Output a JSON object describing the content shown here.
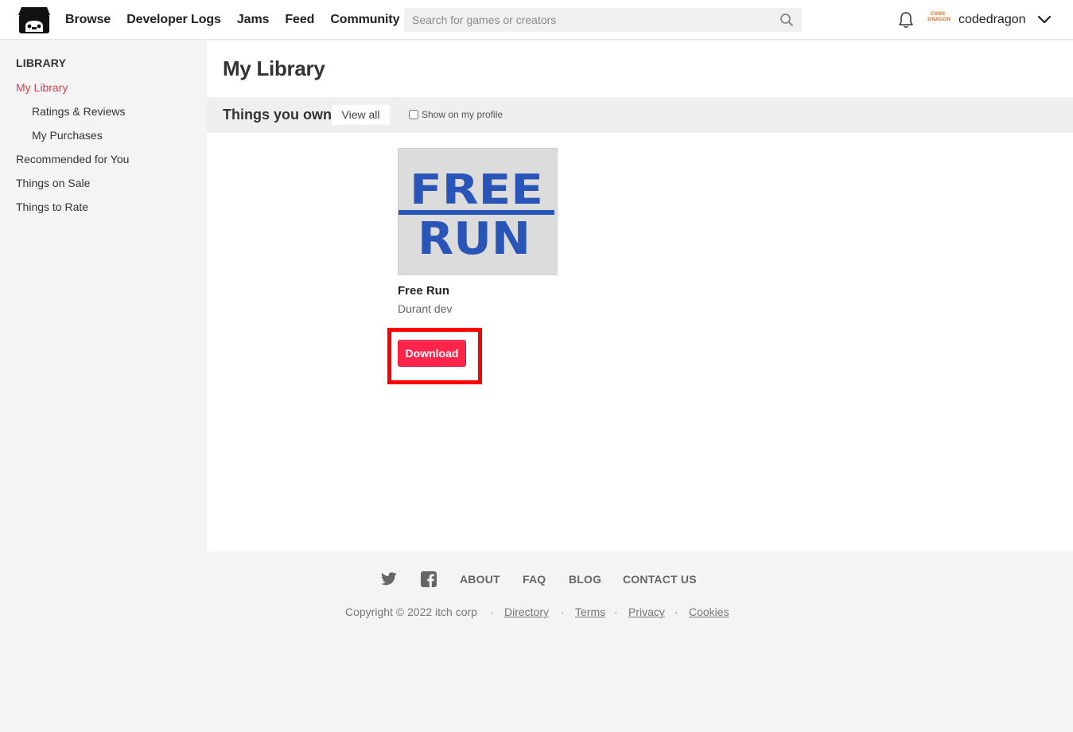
{
  "header": {
    "logo_icon": "itchio-storefront-logo-icon",
    "nav": [
      "Browse",
      "Developer Logs",
      "Jams",
      "Feed",
      "Community"
    ],
    "search_placeholder": "Search for games or creators",
    "search_icon": "search-icon",
    "notifications_icon": "bell-icon",
    "avatar_text": "CODE DRAGON",
    "username": "codedragon",
    "menu_icon": "chevron-down-icon"
  },
  "sidebar": {
    "title": "LIBRARY",
    "items": [
      "My Library",
      "Ratings & Reviews",
      "My Purchases",
      "Recommended for You",
      "Things on Sale",
      "Things to Rate"
    ],
    "active": "My Library"
  },
  "main": {
    "title": "My Library",
    "section": {
      "title": "Things you own",
      "view_all": "View all",
      "show_on_profile": "Show on my profile",
      "show_on_profile_checked": false
    },
    "games": [
      {
        "title": "Free Run",
        "author": "Durant dev",
        "cover_line1": "FREE",
        "cover_line2": "RUN",
        "download_label": "Download"
      }
    ]
  },
  "footer": {
    "social": [
      "twitter-icon",
      "facebook-icon"
    ],
    "links": [
      "ABOUT",
      "FAQ",
      "BLOG",
      "CONTACT US"
    ],
    "copyright": "Copyright © 2022 itch corp",
    "separator": "·",
    "legal": [
      "Directory",
      "Terms",
      "Privacy",
      "Cookies"
    ]
  },
  "colors": {
    "accent": "#d93c4a",
    "download": "#ff2449",
    "highlight": "#ff0000",
    "cover_text": "#2a55b8"
  }
}
